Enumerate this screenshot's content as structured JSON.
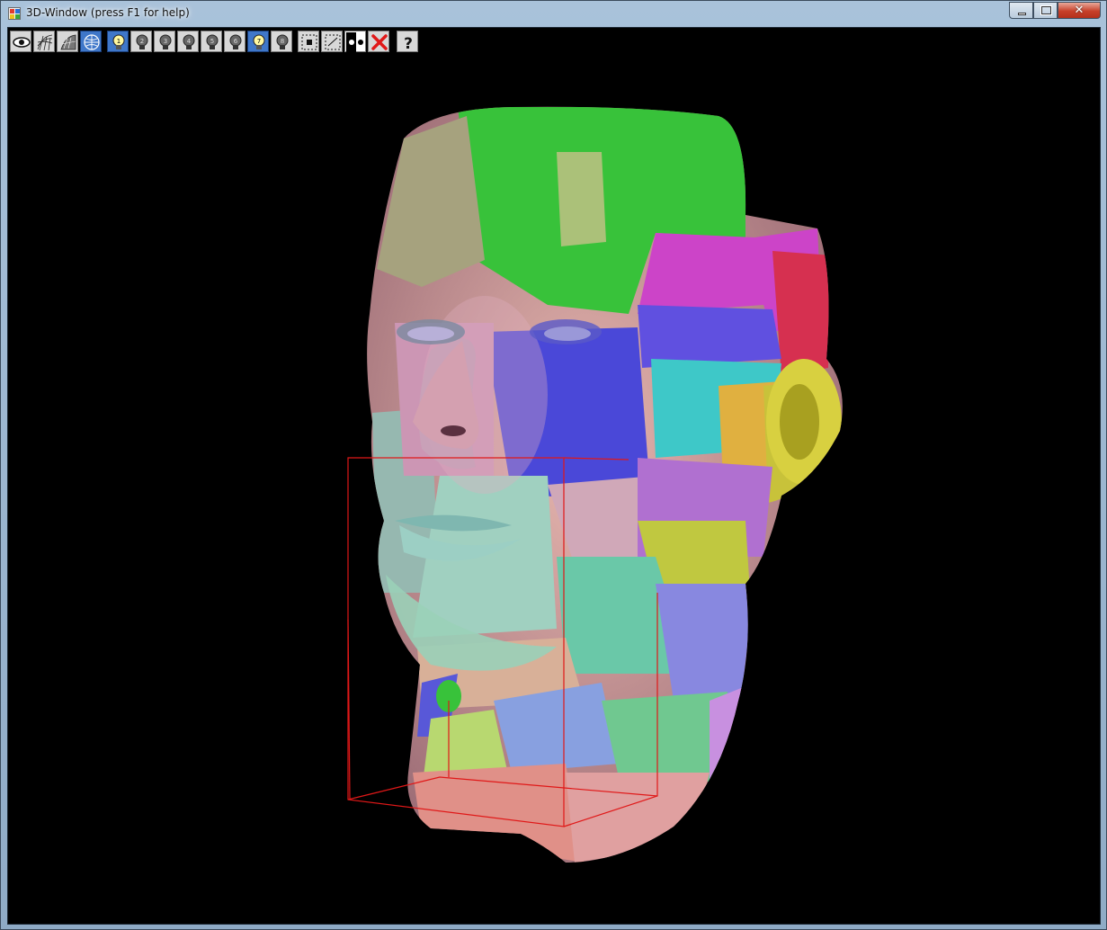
{
  "window": {
    "title": "3D-Window (press F1 for help)"
  },
  "title_controls": {
    "close_glyph": "✕"
  },
  "toolbar": {
    "help_glyph": "?"
  },
  "colors": {
    "viewport_background": "#000000",
    "bounding_box": "#e01818",
    "active_button": "#3f77c9"
  },
  "icons": [
    "eye-icon",
    "wireframe-icon",
    "shaded-icon",
    "textured-globe-icon",
    "light-1-icon",
    "light-2-icon",
    "light-3-icon",
    "light-4-icon",
    "light-5-icon",
    "light-6-icon",
    "light-7-icon",
    "light-8-icon",
    "select-box-icon",
    "deselect-box-icon",
    "toggle-points-icon",
    "delete-icon",
    "help-icon"
  ]
}
